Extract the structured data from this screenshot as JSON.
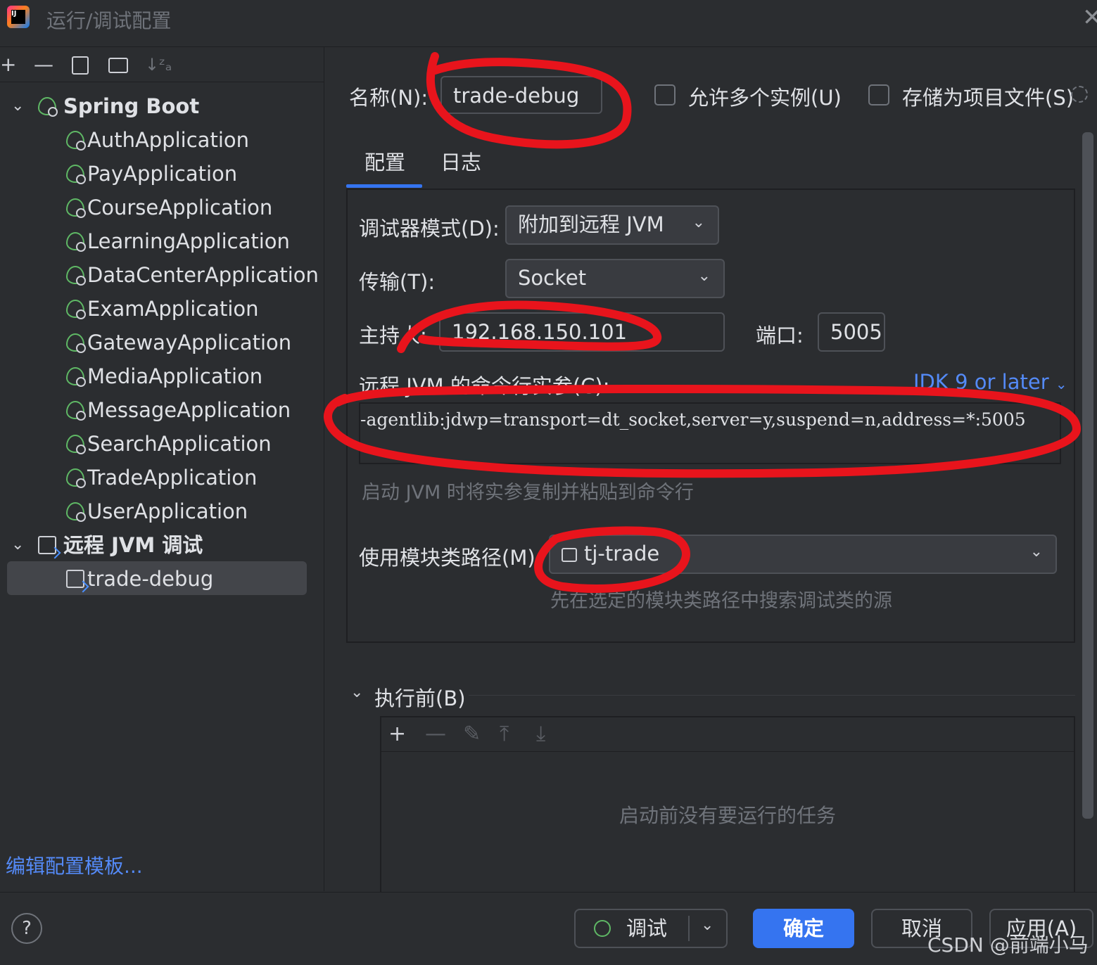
{
  "window": {
    "title": "运行/调试配置",
    "close_icon": "✕"
  },
  "left_toolbar": {
    "add": "+",
    "remove": "—",
    "copy": "copy-icon",
    "new_folder": "folder-icon",
    "sort": "↓ᶻₐ"
  },
  "tree": {
    "groups": [
      {
        "label": "Spring Boot",
        "items": [
          "AuthApplication",
          "PayApplication",
          "CourseApplication",
          "LearningApplication",
          "DataCenterApplication",
          "ExamApplication",
          "GatewayApplication",
          "MediaApplication",
          "MessageApplication",
          "SearchApplication",
          "TradeApplication",
          "UserApplication"
        ]
      },
      {
        "label": "远程 JVM 调试",
        "items": [
          "trade-debug"
        ]
      }
    ],
    "selected": "trade-debug"
  },
  "edit_templates_link": "编辑配置模板...",
  "name_row": {
    "label": "名称(N):",
    "value": "trade-debug",
    "allow_multiple_label": "允许多个实例(U)",
    "store_project_label": "存储为项目文件(S)"
  },
  "tabs": [
    {
      "label": "配置",
      "active": true
    },
    {
      "label": "日志",
      "active": false
    }
  ],
  "config": {
    "debugger_mode_label": "调试器模式(D):",
    "debugger_mode_value": "附加到远程 JVM",
    "transport_label": "传输(T):",
    "transport_value": "Socket",
    "host_label": "主持人:",
    "host_value": "192.168.150.101",
    "port_label": "端口:",
    "port_value": "5005",
    "jvm_args_label": "远程 JVM 的命令行实参(C):",
    "jdk_link": "JDK 9 or later",
    "jvm_args_value": "-agentlib:jdwp=transport=dt_socket,server=y,suspend=n,address=*:5005",
    "jvm_args_hint": "启动 JVM 时将实参复制并粘贴到命令行",
    "module_label": "使用模块类路径(M):",
    "module_value": "tj-trade",
    "module_hint": "先在选定的模块类路径中搜索调试类的源"
  },
  "before_launch": {
    "label": "执行前(B)",
    "empty_text": "启动前没有要运行的任务",
    "toolbar": {
      "add": "+",
      "remove": "—",
      "edit": "✎",
      "up": "⤒",
      "down": "⤓"
    }
  },
  "footer": {
    "help": "?",
    "debug_label": "调试",
    "ok_label": "确定",
    "cancel_label": "取消",
    "apply_label": "应用(A)"
  },
  "watermark": "CSDN @前端小马",
  "colors": {
    "accent": "#3574f0",
    "link": "#548af7",
    "annotation": "#e8141c",
    "spring": "#5fb865"
  }
}
